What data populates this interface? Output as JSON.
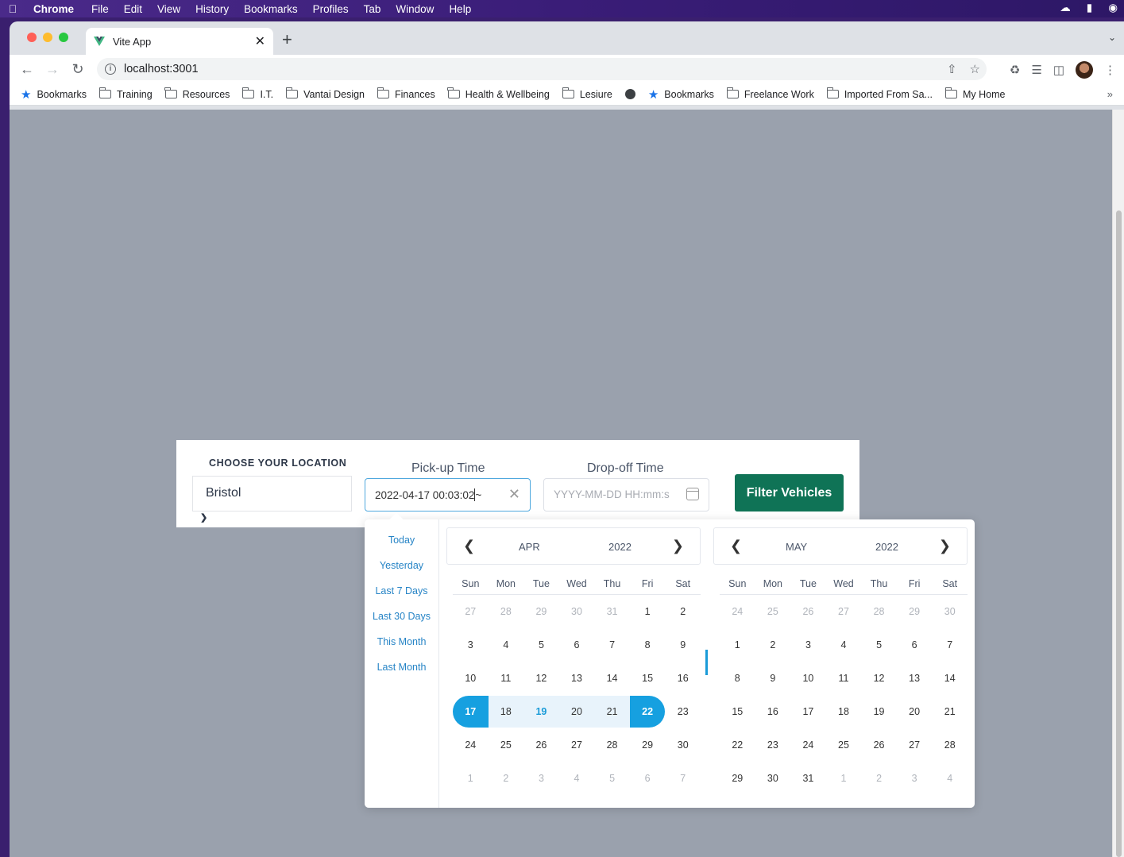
{
  "menubar": {
    "app": "Chrome",
    "items": [
      "File",
      "Edit",
      "View",
      "History",
      "Bookmarks",
      "Profiles",
      "Tab",
      "Window",
      "Help"
    ]
  },
  "browser": {
    "tab_title": "Vite App",
    "url": "localhost:3001",
    "bookmarks": [
      "Bookmarks",
      "Training",
      "Resources",
      "I.T.",
      "Vantai Design",
      "Finances",
      "Health & Wellbeing",
      "Lesiure",
      "Bookmarks",
      "Freelance Work",
      "Imported From Sa...",
      "My Home"
    ]
  },
  "filter": {
    "location_label": "CHOOSE YOUR LOCATION",
    "location_value": "Bristol",
    "pickup_label": "Pick-up Time",
    "pickup_value": "2022-04-17 00:03:02",
    "pickup_suffix": " ~",
    "dropoff_label": "Drop-off Time",
    "dropoff_placeholder": "YYYY-MM-DD HH:mm:s",
    "button_label": "Filter Vehicles"
  },
  "datepicker": {
    "shortcuts": [
      "Today",
      "Yesterday",
      "Last 7 Days",
      "Last 30 Days",
      "This Month",
      "Last Month"
    ],
    "weekdays": [
      "Sun",
      "Mon",
      "Tue",
      "Wed",
      "Thu",
      "Fri",
      "Sat"
    ],
    "left": {
      "month": "APR",
      "year": "2022",
      "weeks": [
        [
          "27",
          "28",
          "29",
          "30",
          "31",
          "1",
          "2"
        ],
        [
          "3",
          "4",
          "5",
          "6",
          "7",
          "8",
          "9"
        ],
        [
          "10",
          "11",
          "12",
          "13",
          "14",
          "15",
          "16"
        ],
        [
          "17",
          "18",
          "19",
          "20",
          "21",
          "22",
          "23"
        ],
        [
          "24",
          "25",
          "26",
          "27",
          "28",
          "29",
          "30"
        ],
        [
          "1",
          "2",
          "3",
          "4",
          "5",
          "6",
          "7"
        ]
      ]
    },
    "right": {
      "month": "MAY",
      "year": "2022",
      "weeks": [
        [
          "24",
          "25",
          "26",
          "27",
          "28",
          "29",
          "30"
        ],
        [
          "1",
          "2",
          "3",
          "4",
          "5",
          "6",
          "7"
        ],
        [
          "8",
          "9",
          "10",
          "11",
          "12",
          "13",
          "14"
        ],
        [
          "15",
          "16",
          "17",
          "18",
          "19",
          "20",
          "21"
        ],
        [
          "22",
          "23",
          "24",
          "25",
          "26",
          "27",
          "28"
        ],
        [
          "29",
          "30",
          "31",
          "1",
          "2",
          "3",
          "4"
        ]
      ]
    },
    "range_start": "17",
    "range_end": "22",
    "today": "19",
    "colors": {
      "accent": "#16a0e0",
      "range_bg": "#e8f3fb",
      "button": "#0f7356"
    }
  }
}
